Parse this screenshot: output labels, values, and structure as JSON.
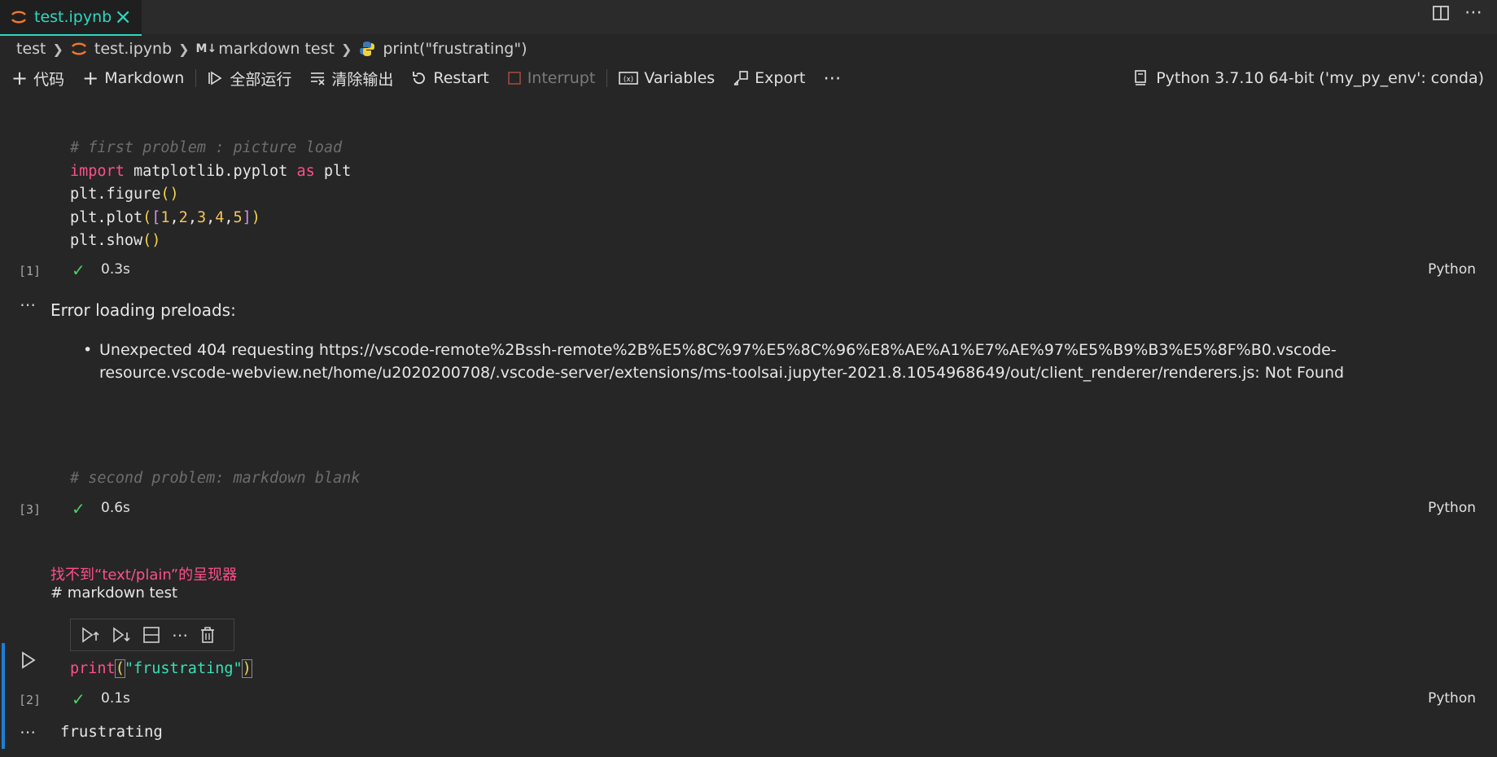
{
  "tab": {
    "name": "test.ipynb",
    "close_glyph": "×"
  },
  "tab_actions": {
    "split_icon": "split-editor-icon",
    "more_glyph": "⋯"
  },
  "breadcrumb": {
    "folder": "test",
    "file": "test.ipynb",
    "md_prefix": "M↓",
    "section": "markdown test",
    "symbol": "print(\"frustrating\")"
  },
  "toolbar": {
    "code_label": "代码",
    "markdown_label": "Markdown",
    "run_all_label": "全部运行",
    "clear_label": "清除输出",
    "restart_label": "Restart",
    "interrupt_label": "Interrupt",
    "variables_label": "Variables",
    "export_label": "Export",
    "more_glyph": "⋯",
    "kernel_label": "Python 3.7.10 64-bit ('my_py_env': conda)"
  },
  "cells": [
    {
      "code_lines": {
        "l1": "# first problem : picture load",
        "l2_kw": "import",
        "l2_a": " matplotlib.pyplot ",
        "l2_kw2": "as",
        "l2_b": " plt",
        "l3_a": "plt.figure",
        "l3_p": "()",
        "l4_a": "plt.plot",
        "l4_open": "(",
        "l4_br1": "[",
        "n1": "1",
        "n2": "2",
        "n3": "3",
        "n4": "4",
        "n5": "5",
        "l4_br2": "]",
        "l4_close": ")",
        "l5_a": "plt.show",
        "l5_p": "()",
        "comma": ","
      },
      "exec_count": "[1]",
      "time": "0.3s",
      "lang": "Python",
      "output": {
        "dots": "⋯",
        "title": "Error loading preloads:",
        "bullet": "•",
        "item": "Unexpected 404 requesting https://vscode-remote%2Bssh-remote%2B%E5%8C%97%E5%8C%96%E8%AE%A1%E7%AE%97%E5%B9%B3%E5%8F%B0.vscode-resource.vscode-webview.net/home/u2020200708/.vscode-server/extensions/ms-toolsai.jupyter-2021.8.1054968649/out/client_renderer/renderers.js: Not Found"
      }
    },
    {
      "comment": "# second problem: markdown blank",
      "exec_count": "[3]",
      "time": "0.6s",
      "lang": "Python"
    },
    {
      "markdown_error": "找不到“text/plain”的呈现器",
      "markdown_source": "# markdown test"
    },
    {
      "code": {
        "fn": "print",
        "open": "(",
        "str": "\"frustrating\"",
        "close": ")"
      },
      "exec_count": "[2]",
      "time": "0.1s",
      "lang": "Python",
      "output": {
        "dots": "⋯",
        "text": "frustrating"
      }
    }
  ],
  "check_glyph": "✓",
  "colors": {
    "accent": "#2bd9c2",
    "keyword": "#ff4f8b",
    "number": "#f6c35b",
    "string": "#38e0b5",
    "success": "#4bd163",
    "focus": "#1e7fd1"
  }
}
